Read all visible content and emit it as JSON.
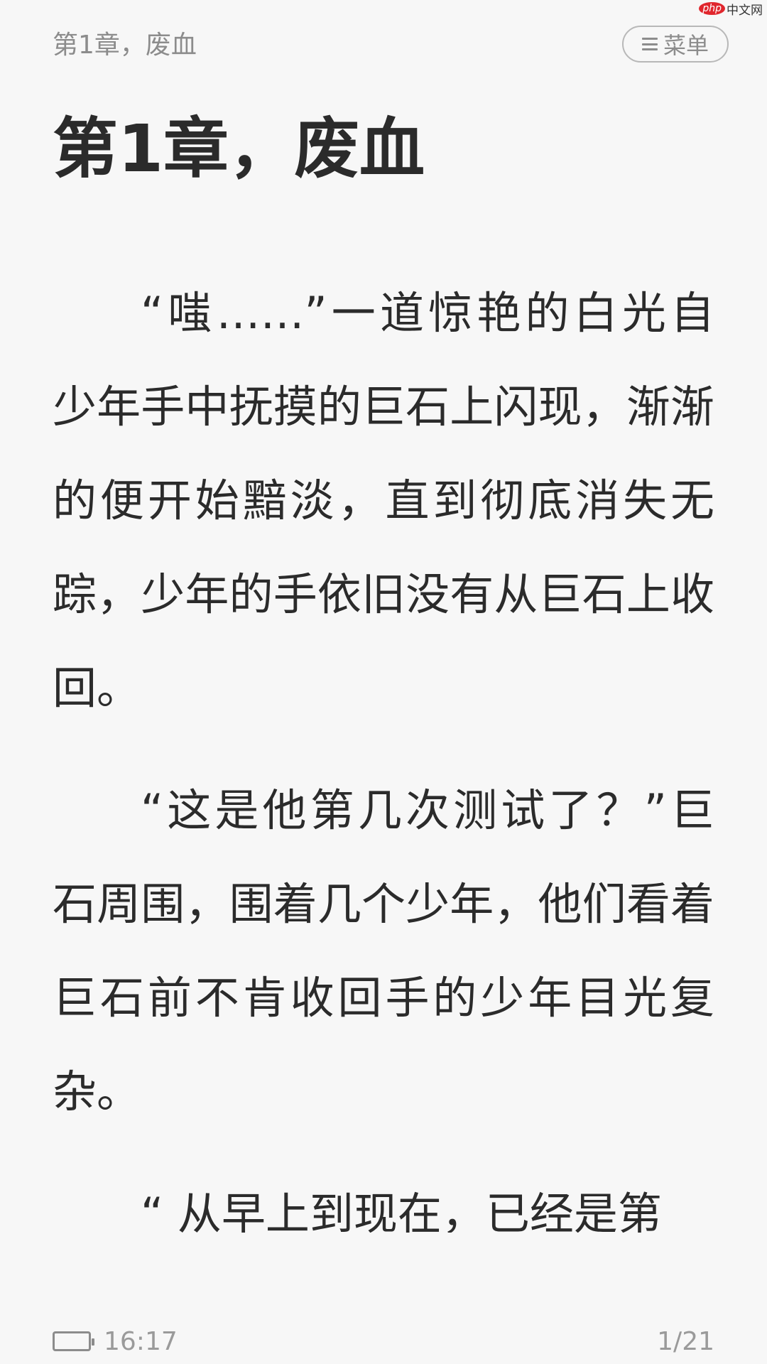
{
  "watermark": {
    "php": "php",
    "cn": "中文网"
  },
  "header": {
    "chapter_label": "第1章，废血",
    "menu_label": "菜单",
    "menu_icon": "hamburger-icon"
  },
  "chapter": {
    "title": "第1章，废血"
  },
  "content": {
    "paragraphs": [
      "“嗤……”一道惊艳的白光自少年手中抚摸的巨石上闪现，渐渐的便开始黯淡，直到彻底消失无踪，少年的手依旧没有从巨石上收回。",
      "“这是他第几次测试了？”巨石周围，围着几个少年，他们看着巨石前不肯收回手的少年目光复杂。",
      "“ 从早上到现在，已经是第"
    ]
  },
  "footer": {
    "battery_icon": "battery-icon",
    "battery_level": 1.0,
    "time": "16:17",
    "page_indicator": "1/21"
  },
  "colors": {
    "background": "#f7f7f7",
    "text": "#2b2b2b",
    "secondary_text": "#8c8c8c",
    "watermark_red": "#e0262d"
  }
}
